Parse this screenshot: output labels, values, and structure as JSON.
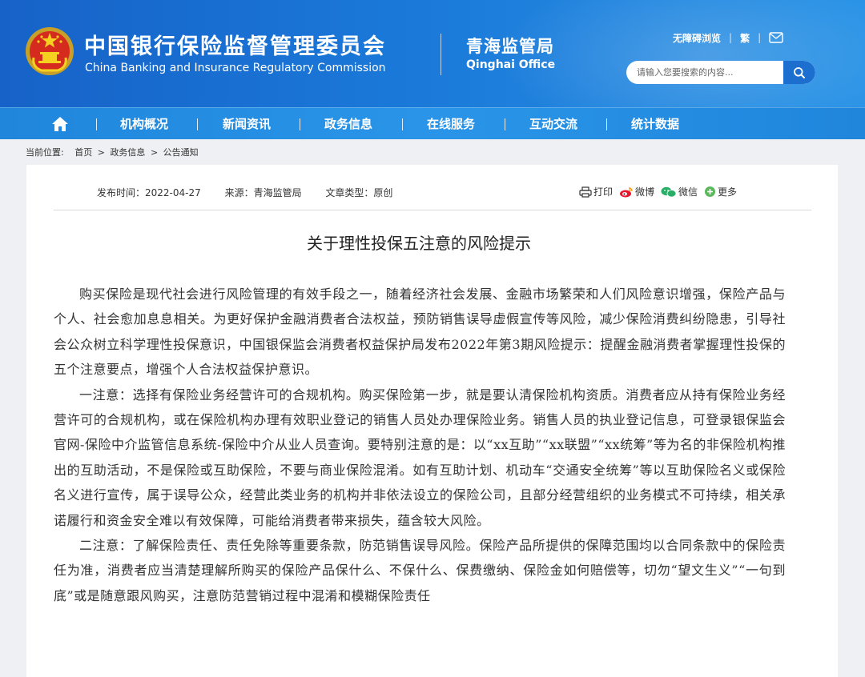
{
  "header": {
    "cn_name": "中国银行保险监督管理委员会",
    "en_name": "China Banking and Insurance Regulatory Commission",
    "office_cn": "青海监管局",
    "office_en": "Qinghai Office",
    "accessibility_link": "无障碍浏览",
    "traditional_link": "繁",
    "search_placeholder": "请输入您要搜索的内容...",
    "emblem_icon": "national-emblem-icon",
    "mail_icon": "mail-icon",
    "search_icon": "search-icon"
  },
  "nav": {
    "home_icon": "home-icon",
    "items": [
      "机构概况",
      "新闻资讯",
      "政务信息",
      "在线服务",
      "互动交流",
      "统计数据"
    ]
  },
  "breadcrumb": {
    "label": "当前位置:",
    "items": [
      "首页",
      ">",
      "政务信息",
      ">",
      "公告通知"
    ]
  },
  "article": {
    "publish_time": "发布时间：2022-04-27",
    "source": "来源：青海监管局",
    "type": "文章类型：原创",
    "share": {
      "print": "打印",
      "weibo": "微博",
      "wechat": "微信",
      "more": "更多"
    },
    "title": "关于理性投保五注意的风险提示",
    "paragraphs": [
      "购买保险是现代社会进行风险管理的有效手段之一，随着经济社会发展、金融市场繁荣和人们风险意识增强，保险产品与个人、社会愈加息息相关。为更好保护金融消费者合法权益，预防销售误导虚假宣传等风险，减少保险消费纠纷隐患，引导社会公众树立科学理性投保意识，中国银保监会消费者权益保护局发布2022年第3期风险提示：提醒金融消费者掌握理性投保的五个注意要点，增强个人合法权益保护意识。",
      "一注意：选择有保险业务经营许可的合规机构。购买保险第一步，就是要认清保险机构资质。消费者应从持有保险业务经营许可的合规机构，或在保险机构办理有效职业登记的销售人员处办理保险业务。销售人员的执业登记信息，可登录银保监会官网-保险中介监管信息系统-保险中介从业人员查询。要特别注意的是：以“xx互助”“xx联盟”“xx统筹”等为名的非保险机构推出的互助活动，不是保险或互助保险，不要与商业保险混淆。如有互助计划、机动车“交通安全统筹”等以互助保险名义或保险名义进行宣传，属于误导公众，经营此类业务的机构并非依法设立的保险公司，且部分经营组织的业务模式不可持续，相关承诺履行和资金安全难以有效保障，可能给消费者带来损失，蕴含较大风险。",
      "二注意：了解保险责任、责任免除等重要条款，防范销售误导风险。保险产品所提供的保障范围均以合同条款中的保险责任为准，消费者应当清楚理解所购买的保险产品保什么、不保什么、保费缴纳、保险金如何赔偿等，切勿“望文生义”“一句到底”或是随意跟风购买，注意防范营销过程中混淆和模糊保险责任"
    ]
  }
}
